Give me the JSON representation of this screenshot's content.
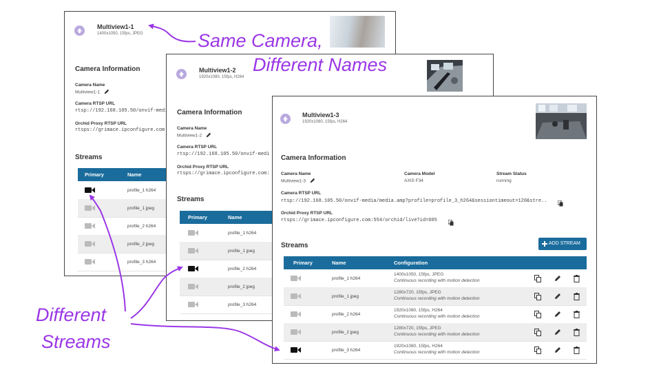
{
  "card1": {
    "title": "Multiview1-1",
    "subtitle": "1400x1050, 15fps, JPEG",
    "section_info": "Camera Information",
    "camera_name_label": "Camera Name",
    "camera_name": "Multiview1-1",
    "rtsp_label": "Camera RTSP URL",
    "rtsp_url": "rtsp://192.168.105.50/onvif-media",
    "proxy_label": "Orchid Proxy RTSP URL",
    "proxy_url": "rtsps://grimace.ipconfigure.com",
    "streams_title": "Streams",
    "col_primary": "Primary",
    "col_name": "Name",
    "rows": [
      {
        "name": "profile_1 h264",
        "primary": true
      },
      {
        "name": "profile_1 jpeg",
        "primary": false
      },
      {
        "name": "profile_2 h264",
        "primary": false
      },
      {
        "name": "profile_2 jpeg",
        "primary": false
      },
      {
        "name": "profile_3 h264",
        "primary": false
      }
    ]
  },
  "card2": {
    "title": "Multiview1-2",
    "subtitle": "1920x1080, 15fps, H264",
    "section_info": "Camera Information",
    "camera_name_label": "Camera Name",
    "camera_name": "Multiview1-2",
    "rtsp_label": "Camera RTSP URL",
    "rtsp_url": "rtsp://192.168.105.50/onvif-medi",
    "proxy_label": "Orchid Proxy RTSP URL",
    "proxy_url": "rtsps://grimace.ipconfigure.com:",
    "streams_title": "Streams",
    "col_primary": "Primary",
    "col_name": "Name",
    "rows": [
      {
        "name": "profile_1 h264",
        "primary": false
      },
      {
        "name": "profile_1 jpeg",
        "primary": false
      },
      {
        "name": "profile_2 h264",
        "primary": true
      },
      {
        "name": "profile_2 jpeg",
        "primary": false
      },
      {
        "name": "profile_3 h264",
        "primary": false
      }
    ]
  },
  "card3": {
    "title": "Multiview1-3",
    "subtitle": "1920x1080, 15fps, H264",
    "section_info": "Camera Information",
    "camera_name_label": "Camera Name",
    "camera_name": "Multiview1-3",
    "model_label": "Camera Model",
    "model": "AXIS F34",
    "status_label": "Stream Status",
    "status": "running",
    "rtsp_label": "Camera RTSP URL",
    "rtsp_url": "rtsp://192.168.105.50/onvif-media/media.amp?profile=profile_3_h264&sessiontimeout=120&stre..",
    "proxy_label": "Orchid Proxy RTSP URL",
    "proxy_url": "rtsps://grimace.ipconfigure.com:554/orchid/live?id=605",
    "streams_title": "Streams",
    "add_stream": "ADD STREAM",
    "col_primary": "Primary",
    "col_name": "Name",
    "col_config": "Configuration",
    "rows": [
      {
        "name": "profile_1 h264",
        "config": "1400x1050, 15fps, JPEG",
        "mode": "Continuous recording with motion detection",
        "primary": false
      },
      {
        "name": "profile_1 jpeg",
        "config": "1280x720, 15fps, JPEG",
        "mode": "Continuous recording with motion detection",
        "primary": false
      },
      {
        "name": "profile_2 h264",
        "config": "1920x1080, 15fps, H264",
        "mode": "Continuous recording with motion detection",
        "primary": false
      },
      {
        "name": "profile_2 jpeg",
        "config": "1280x720, 15fps, JPEG",
        "mode": "Continuous recording with motion detection",
        "primary": false
      },
      {
        "name": "profile_3 h264",
        "config": "1920x1080, 15fps, H264",
        "mode": "Continuous recording with motion detection",
        "primary": true
      }
    ]
  },
  "annotations": {
    "same_line1": "Same Camera,",
    "same_line2": "Different Names",
    "diff_line1": "Different",
    "diff_line2": "Streams"
  },
  "colors": {
    "table_header": "#1a6c9c",
    "annotation": "#9a36e6",
    "primary_icon": "#111111",
    "inactive_icon": "#bbbbbb",
    "header_icon": "#b9a9de"
  },
  "icons": [
    "up-arrow-circle-icon",
    "pencil-icon",
    "video-camera-icon",
    "copy-icon",
    "delete-icon",
    "plus-icon"
  ]
}
